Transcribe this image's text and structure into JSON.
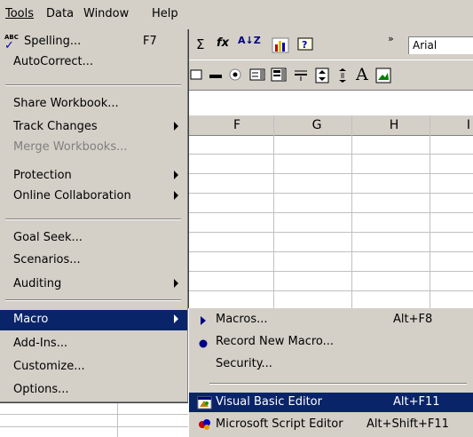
{
  "menubar": {
    "tools": "Tools",
    "data": "Data",
    "window": "Window",
    "help": "Help"
  },
  "toolbar": {
    "sigma": "Σ",
    "fx": "fx",
    "sort": "A↓Z",
    "font": "Arial"
  },
  "columns": [
    "F",
    "G",
    "H",
    "I"
  ],
  "tools_menu": {
    "spelling": "Spelling...",
    "spelling_key": "F7",
    "autocorrect": "AutoCorrect...",
    "share": "Share Workbook...",
    "track": "Track Changes",
    "merge": "Merge Workbooks...",
    "protection": "Protection",
    "online": "Online Collaboration",
    "goalseek": "Goal Seek...",
    "scenarios": "Scenarios...",
    "auditing": "Auditing",
    "macro": "Macro",
    "addins": "Add-Ins...",
    "customize": "Customize...",
    "options": "Options..."
  },
  "macro_menu": {
    "macros": "Macros...",
    "macros_key": "Alt+F8",
    "record": "Record New Macro...",
    "security": "Security...",
    "vbe": "Visual Basic Editor",
    "vbe_key": "Alt+F11",
    "script": "Microsoft Script Editor",
    "script_key": "Alt+Shift+F11"
  },
  "colors": {
    "menu_bg": "#d4d0c8",
    "highlight": "#0a246a"
  }
}
